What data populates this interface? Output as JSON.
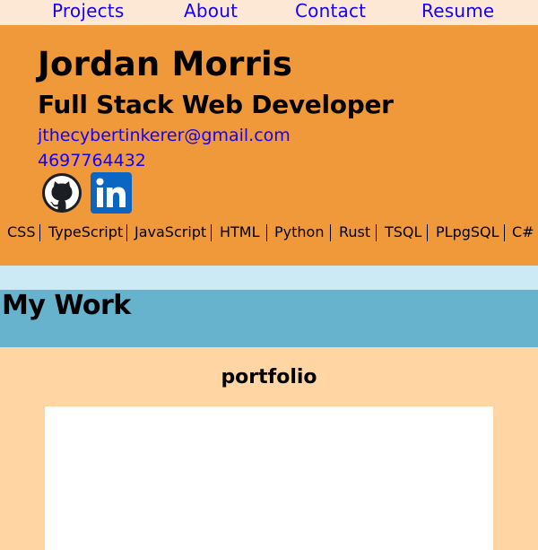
{
  "nav": {
    "projects": "Projects",
    "about": "About",
    "contact": "Contact",
    "resume": "Resume"
  },
  "header": {
    "name": "Jordan Morris",
    "title": "Full Stack Web Developer",
    "email": "jthecybertinkerer@gmail.com",
    "phone": "4697764432",
    "social": [
      {
        "name": "github-icon"
      },
      {
        "name": "linkedin-icon"
      }
    ],
    "skills": [
      "CSS",
      "TypeScript",
      "JavaScript",
      "HTML",
      "Python",
      "Rust",
      "TSQL",
      "PLpgSQL",
      "C#"
    ]
  },
  "work": {
    "heading": "My Work"
  },
  "portfolio": {
    "heading": "portfolio"
  },
  "colors": {
    "nav_bg": "#fde8d5",
    "header_bg": "#f0993b",
    "band_light": "#cbeaf5",
    "band_dark": "#67b2cc",
    "body_bg": "#ffd5a4",
    "link": "#1500ff"
  }
}
